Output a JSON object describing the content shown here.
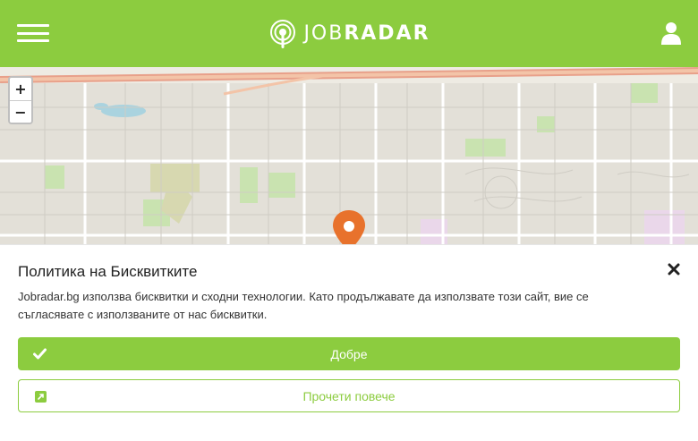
{
  "colors": {
    "brand": "#8ccc3f",
    "marker": "#e8722c",
    "map_land": "#eeebe3"
  },
  "header": {
    "logo_light": "JOB",
    "logo_bold": "RADAR",
    "menu_icon": "hamburger-icon",
    "account_icon": "user-icon"
  },
  "map": {
    "zoom_in_label": "+",
    "zoom_out_label": "−",
    "marker_icon": "map-marker-icon"
  },
  "cookie_banner": {
    "title": "Политика на Бисквитките",
    "close_icon": "close-icon",
    "text": "Jobradar.bg използва бисквитки и сходни технологии. Като продължавате да използвате този сайт, вие се съгласявате с използваните от нас бисквитки.",
    "accept_label": "Добре",
    "accept_icon": "check-icon",
    "read_more_label": "Прочети повече",
    "read_more_icon": "external-link-icon"
  }
}
